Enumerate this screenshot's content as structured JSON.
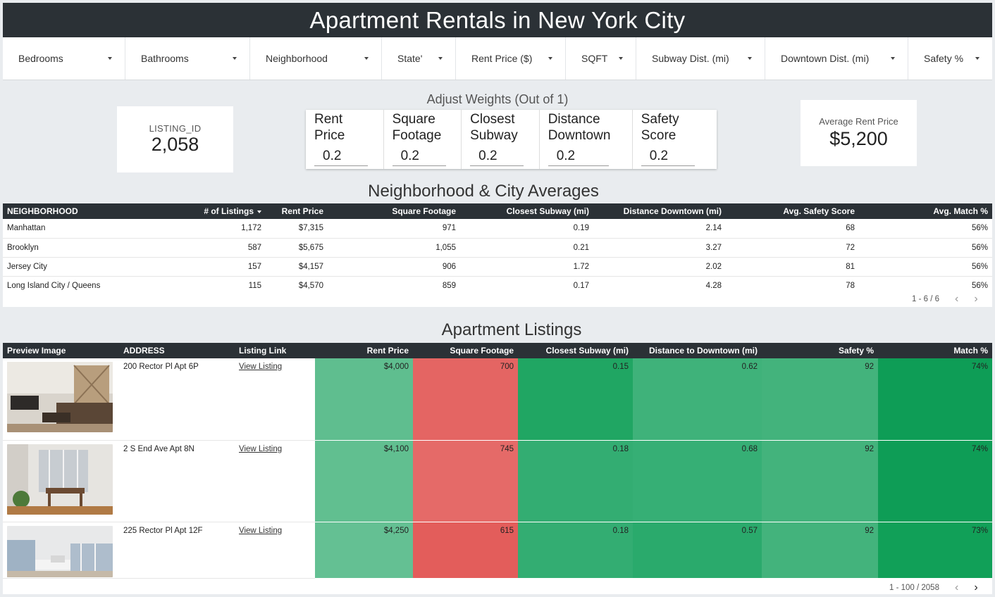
{
  "title": "Apartment Rentals in New York City",
  "filters": [
    {
      "label": "Bedrooms"
    },
    {
      "label": "Bathrooms"
    },
    {
      "label": "Neighborhood"
    },
    {
      "label": "State'"
    },
    {
      "label": "Rent Price ($)"
    },
    {
      "label": "SQFT"
    },
    {
      "label": "Subway Dist. (mi)"
    },
    {
      "label": "Downtown Dist. (mi)"
    },
    {
      "label": "Safety %"
    }
  ],
  "listing_card": {
    "label": "LISTING_ID",
    "value": "2,058"
  },
  "weights": {
    "title": "Adjust Weights (Out of 1)",
    "items": [
      {
        "label": "Rent Price",
        "value": "0.2"
      },
      {
        "label": "Square Footage",
        "value": "0.2"
      },
      {
        "label": "Closest Subway",
        "value": "0.2"
      },
      {
        "label": "Distance Downtown",
        "value": "0.2"
      },
      {
        "label": "Safety Score",
        "value": "0.2"
      }
    ]
  },
  "avg_card": {
    "label": "Average Rent Price",
    "value": "$5,200"
  },
  "neighborhood": {
    "title": "Neighborhood & City Averages",
    "headers": [
      "NEIGHBORHOOD",
      "# of Listings",
      "Rent Price",
      "Square Footage",
      "Closest Subway (mi)",
      "Distance Downtown (mi)",
      "Avg. Safety Score",
      "Avg. Match %"
    ],
    "rows": [
      [
        "Manhattan",
        "1,172",
        "$7,315",
        "971",
        "0.19",
        "2.14",
        "68",
        "56%"
      ],
      [
        "Brooklyn",
        "587",
        "$5,675",
        "1,055",
        "0.21",
        "3.27",
        "72",
        "56%"
      ],
      [
        "Jersey City",
        "157",
        "$4,157",
        "906",
        "1.72",
        "2.02",
        "81",
        "56%"
      ],
      [
        "Long Island City / Queens",
        "115",
        "$4,570",
        "859",
        "0.17",
        "4.28",
        "78",
        "56%"
      ]
    ],
    "pager": "1 - 6 / 6"
  },
  "listings": {
    "title": "Apartment Listings",
    "headers": [
      "Preview Image",
      "ADDRESS",
      "Listing Link",
      "Rent Price",
      "Square Footage",
      "Closest Subway (mi)",
      "Distance to Downtown (mi)",
      "Safety %",
      "Match %"
    ],
    "link_label": "View Listing",
    "rows": [
      {
        "address": "200 Rector Pl Apt 6P",
        "rent": "$4,000",
        "sqft": "700",
        "subway": "0.15",
        "downtown": "0.62",
        "safety": "92",
        "match": "74%",
        "colors": [
          "#5fbe8f",
          "#e46563",
          "#20a663",
          "#3fb27a",
          "#43b37c",
          "#0e9d56"
        ]
      },
      {
        "address": "2 S End Ave Apt 8N",
        "rent": "$4,100",
        "sqft": "745",
        "subway": "0.18",
        "downtown": "0.68",
        "safety": "92",
        "match": "74%",
        "colors": [
          "#61bf90",
          "#e56a68",
          "#33ad72",
          "#36af75",
          "#43b37c",
          "#0e9d56"
        ]
      },
      {
        "address": "225 Rector Pl Apt 12F",
        "rent": "$4,250",
        "sqft": "615",
        "subway": "0.18",
        "downtown": "0.57",
        "safety": "92",
        "match": "73%",
        "colors": [
          "#64c093",
          "#e35d5b",
          "#33ad72",
          "#2aaa6c",
          "#43b37c",
          "#11a058"
        ]
      }
    ],
    "pager": "1 - 100 / 2058"
  }
}
